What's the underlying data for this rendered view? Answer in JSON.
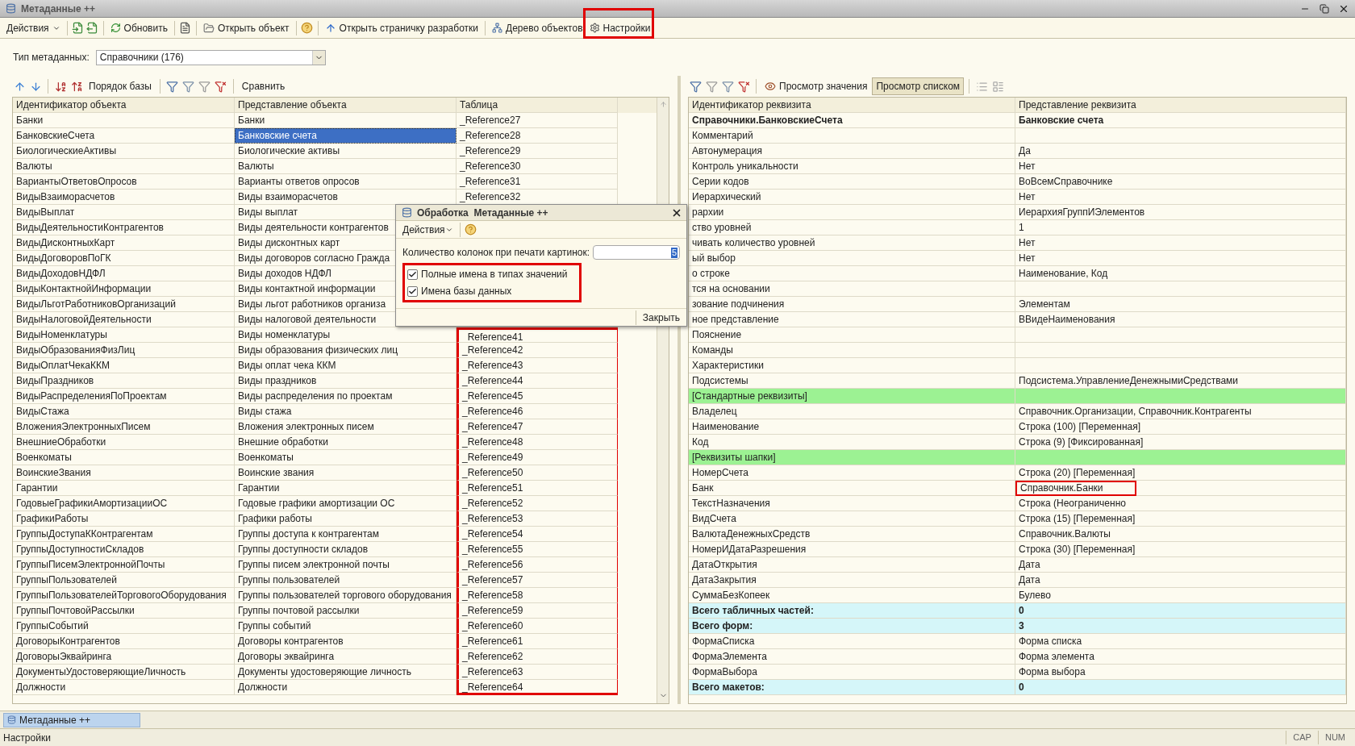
{
  "window": {
    "title": "Метаданные ++"
  },
  "toolbar": {
    "actions": "Действия",
    "refresh": "Обновить",
    "open_object": "Открыть объект",
    "open_dev_page": "Открыть страничку разработки",
    "object_tree": "Дерево объектов",
    "settings": {
      "label": "Настройки",
      "highlighted": true
    }
  },
  "metadata_type": {
    "label": "Тип метаданных:",
    "value": "Справочники (176)"
  },
  "left_toolbar": {
    "base_order": "Порядок базы",
    "compare": "Сравнить"
  },
  "left_table": {
    "columns": [
      "Идентификатор объекта",
      "Представление объекта",
      "Таблица"
    ],
    "rows": [
      {
        "id": "Банки",
        "name": "Банки",
        "table": "_Reference27",
        "selected": false,
        "marked": false
      },
      {
        "id": "БанковскиеСчета",
        "name": "Банковские счета",
        "table": "_Reference28",
        "selected": true,
        "marked": false
      },
      {
        "id": "БиологическиеАктивы",
        "name": "Биологические активы",
        "table": "_Reference29",
        "selected": false,
        "marked": false
      },
      {
        "id": "Валюты",
        "name": "Валюты",
        "table": "_Reference30",
        "selected": false,
        "marked": false
      },
      {
        "id": "ВариантыОтветовОпросов",
        "name": "Варианты ответов опросов",
        "table": "_Reference31",
        "selected": false,
        "marked": false
      },
      {
        "id": "ВидыВзаиморасчетов",
        "name": "Виды взаиморасчетов",
        "table": "_Reference32",
        "selected": false,
        "marked": false
      },
      {
        "id": "ВидыВыплат",
        "name": "Виды выплат",
        "selected": false
      },
      {
        "id": "ВидыДеятельностиКонтрагентов",
        "name": "Виды деятельности контрагентов",
        "selected": false
      },
      {
        "id": "ВидыДисконтныхКарт",
        "name": "Виды дисконтных карт",
        "selected": false
      },
      {
        "id": "ВидыДоговоровПоГК",
        "name": "Виды договоров согласно Гражда",
        "selected": false
      },
      {
        "id": "ВидыДоходовНДФЛ",
        "name": "Виды доходов НДФЛ",
        "selected": false
      },
      {
        "id": "ВидыКонтактнойИнформации",
        "name": "Виды контактной информации",
        "selected": false
      },
      {
        "id": "ВидыЛьготРаботниковОрганизаций",
        "name": "Виды льгот работников организа",
        "selected": false
      },
      {
        "id": "ВидыНалоговойДеятельности",
        "name": "Виды налоговой деятельности",
        "selected": false
      },
      {
        "id": "ВидыНоменклатуры",
        "name": "Виды номенклатуры",
        "table": "_Reference41",
        "selected": false,
        "marked": true
      },
      {
        "id": "ВидыОбразованияФизЛиц",
        "name": "Виды образования физических лиц",
        "table": "_Reference42",
        "selected": false,
        "marked": true
      },
      {
        "id": "ВидыОплатЧекаККМ",
        "name": "Виды оплат чека ККМ",
        "table": "_Reference43",
        "selected": false,
        "marked": true
      },
      {
        "id": "ВидыПраздников",
        "name": "Виды праздников",
        "table": "_Reference44",
        "selected": false,
        "marked": true
      },
      {
        "id": "ВидыРаспределенияПоПроектам",
        "name": "Виды распределения по проектам",
        "table": "_Reference45",
        "selected": false,
        "marked": true
      },
      {
        "id": "ВидыСтажа",
        "name": "Виды стажа",
        "table": "_Reference46",
        "selected": false,
        "marked": true
      },
      {
        "id": "ВложенияЭлектронныхПисем",
        "name": "Вложения электронных писем",
        "table": "_Reference47",
        "selected": false,
        "marked": true
      },
      {
        "id": "ВнешниеОбработки",
        "name": "Внешние обработки",
        "table": "_Reference48",
        "selected": false,
        "marked": true
      },
      {
        "id": "Военкоматы",
        "name": "Военкоматы",
        "table": "_Reference49",
        "selected": false,
        "marked": true
      },
      {
        "id": "ВоинскиеЗвания",
        "name": "Воинские звания",
        "table": "_Reference50",
        "selected": false,
        "marked": true
      },
      {
        "id": "Гарантии",
        "name": "Гарантии",
        "table": "_Reference51",
        "selected": false,
        "marked": true
      },
      {
        "id": "ГодовыеГрафикиАмортизацииОС",
        "name": "Годовые графики амортизации ОС",
        "table": "_Reference52",
        "selected": false,
        "marked": true
      },
      {
        "id": "ГрафикиРаботы",
        "name": "Графики работы",
        "table": "_Reference53",
        "selected": false,
        "marked": true
      },
      {
        "id": "ГруппыДоступаККонтрагентам",
        "name": "Группы доступа к контрагентам",
        "table": "_Reference54",
        "selected": false,
        "marked": true
      },
      {
        "id": "ГруппыДоступностиСкладов",
        "name": "Группы доступности складов",
        "table": "_Reference55",
        "selected": false,
        "marked": true
      },
      {
        "id": "ГруппыПисемЭлектроннойПочты",
        "name": "Группы писем электронной почты",
        "table": "_Reference56",
        "selected": false,
        "marked": true
      },
      {
        "id": "ГруппыПользователей",
        "name": "Группы пользователей",
        "table": "_Reference57",
        "selected": false,
        "marked": true
      },
      {
        "id": "ГруппыПользователейТорговогоОборудования",
        "name": "Группы пользователей торгового оборудования",
        "table": "_Reference58",
        "selected": false,
        "marked": true
      },
      {
        "id": "ГруппыПочтовойРассылки",
        "name": "Группы почтовой рассылки",
        "table": "_Reference59",
        "selected": false,
        "marked": true
      },
      {
        "id": "ГруппыСобытий",
        "name": "Группы событий",
        "table": "_Reference60",
        "selected": false,
        "marked": true
      },
      {
        "id": "ДоговорыКонтрагентов",
        "name": "Договоры контрагентов",
        "table": "_Reference61",
        "selected": false,
        "marked": true
      },
      {
        "id": "ДоговорыЭквайринга",
        "name": "Договоры эквайринга",
        "table": "_Reference62",
        "selected": false,
        "marked": true
      },
      {
        "id": "ДокументыУдостоверяющиеЛичность",
        "name": "Документы удостоверяющие личность",
        "table": "_Reference63",
        "selected": false,
        "marked": true
      },
      {
        "id": "Должности",
        "name": "Должности",
        "table": "_Reference64",
        "selected": false,
        "marked": true
      }
    ]
  },
  "right_toolbar": {
    "view_value": "Просмотр значения",
    "view_list": {
      "label": "Просмотр списком",
      "selected": true
    }
  },
  "right_table": {
    "columns": [
      "Идентификатор реквизита",
      "Представление реквизита"
    ],
    "rows": [
      {
        "kind": "title",
        "id": "Справочники.БанковскиеСчета",
        "value": "Банковские счета",
        "marked": false
      },
      {
        "kind": "plain",
        "id": "Комментарий",
        "marked": false
      },
      {
        "kind": "plain",
        "id": "Автонумерация",
        "value": "Да",
        "marked": false
      },
      {
        "kind": "plain",
        "id": "Контроль уникальности",
        "value": "Нет",
        "marked": false
      },
      {
        "kind": "plain",
        "id": "Серии кодов",
        "value": "ВоВсемСправочнике",
        "marked": false
      },
      {
        "kind": "plain",
        "id": "Иерархический",
        "value": "Нет",
        "marked": false
      },
      {
        "kind": "plain",
        "id": "рархии",
        "value": "ИерархияГруппИЭлементов",
        "marked": false
      },
      {
        "kind": "plain",
        "id": "ство уровней",
        "value": "1",
        "marked": false
      },
      {
        "kind": "plain",
        "id": "чивать количество уровней",
        "value": "Нет",
        "marked": false
      },
      {
        "kind": "plain",
        "id": "ый выбор",
        "value": "Нет",
        "marked": false
      },
      {
        "kind": "plain",
        "id": "о строке",
        "value": "Наименование, Код",
        "marked": false
      },
      {
        "kind": "plain",
        "id": "тся на основании",
        "marked": false
      },
      {
        "kind": "plain",
        "id": "зование подчинения",
        "value": "Элементам",
        "marked": false
      },
      {
        "kind": "plain",
        "id": "ное представление",
        "value": "ВВидеНаименования",
        "marked": false
      },
      {
        "kind": "plain",
        "id": "Пояснение",
        "marked": false
      },
      {
        "kind": "plain",
        "id": "Команды",
        "marked": false
      },
      {
        "kind": "plain",
        "id": "Характеристики",
        "marked": false
      },
      {
        "kind": "plain",
        "id": "Подсистемы",
        "value": "Подсистема.УправлениеДенежнымиСредствами",
        "marked": false
      },
      {
        "kind": "section",
        "id": "[Стандартные реквизиты]",
        "marked": false
      },
      {
        "kind": "plain",
        "id": "Владелец",
        "value": "Справочник.Организации, Справочник.Контрагенты",
        "marked": false
      },
      {
        "kind": "plain",
        "id": "Наименование",
        "value": "Строка (100) [Переменная]",
        "marked": false
      },
      {
        "kind": "plain",
        "id": "Код",
        "value": "Строка (9) [Фиксированная]",
        "marked": false
      },
      {
        "kind": "section",
        "id": "[Реквизиты шапки]",
        "marked": false
      },
      {
        "kind": "plain",
        "id": "НомерСчета",
        "value": "Строка (20) [Переменная]",
        "marked": false
      },
      {
        "kind": "plain",
        "id": "Банк",
        "value": "Справочник.Банки",
        "marked": true
      },
      {
        "kind": "plain",
        "id": "ТекстНазначения",
        "value": "Строка (Неограниченно",
        "marked": false
      },
      {
        "kind": "plain",
        "id": "ВидСчета",
        "value": "Строка (15) [Переменная]",
        "marked": false
      },
      {
        "kind": "plain",
        "id": "ВалютаДенежныхСредств",
        "value": "Справочник.Валюты",
        "marked": false
      },
      {
        "kind": "plain",
        "id": "НомерИДатаРазрешения",
        "value": "Строка (30) [Переменная]",
        "marked": false
      },
      {
        "kind": "plain",
        "id": "ДатаОткрытия",
        "value": "Дата",
        "marked": false
      },
      {
        "kind": "plain",
        "id": "ДатаЗакрытия",
        "value": "Дата",
        "marked": false
      },
      {
        "kind": "plain",
        "id": "СуммаБезКопеек",
        "value": "Булево",
        "marked": false
      },
      {
        "kind": "total",
        "id": "Всего табличных частей:",
        "value": "0",
        "marked": false
      },
      {
        "kind": "total",
        "id": "Всего форм:",
        "value": "3",
        "marked": false
      },
      {
        "kind": "plain",
        "id": "ФормаСписка",
        "value": "Форма списка",
        "marked": false
      },
      {
        "kind": "plain",
        "id": "ФормаЭлемента",
        "value": "Форма элемента",
        "marked": false
      },
      {
        "kind": "plain",
        "id": "ФормаВыбора",
        "value": "Форма выбора",
        "marked": false
      },
      {
        "kind": "total",
        "id": "Всего макетов:",
        "value": "0",
        "marked": false
      }
    ]
  },
  "dialog": {
    "title": "Обработка  Метаданные ++",
    "actions": "Действия",
    "columns_label": "Количество колонок при печати картинок:",
    "columns_value": "5",
    "options": [
      {
        "label": "Полные имена в типах значений",
        "checked": true
      },
      {
        "label": "Имена базы данных",
        "checked": true
      }
    ],
    "options_highlighted": true,
    "close": "Закрыть"
  },
  "taskbar": {
    "label": "Метаданные ++"
  },
  "status_bar": {
    "text": "Настройки",
    "indicators": [
      "CAP",
      "NUM"
    ]
  }
}
